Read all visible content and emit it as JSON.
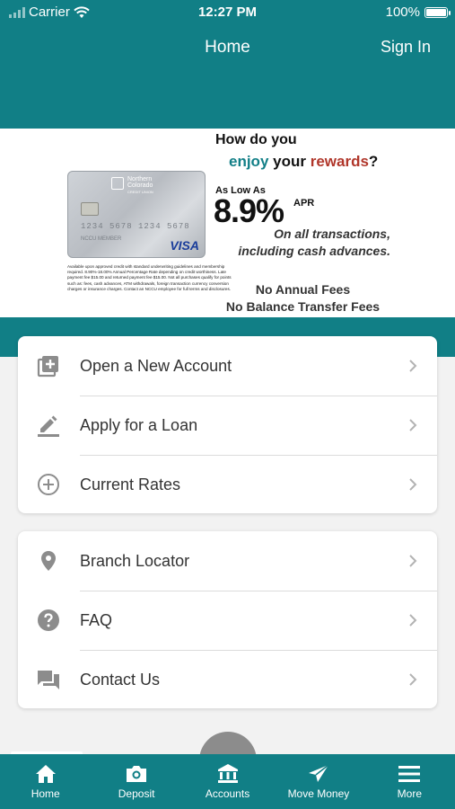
{
  "status_bar": {
    "carrier": "Carrier",
    "time": "12:27 PM",
    "battery": "100%"
  },
  "header": {
    "title": "Home",
    "sign_in": "Sign In"
  },
  "banner": {
    "headline_line1": "How do you",
    "headline_enjoy": "enjoy",
    "headline_your": " your ",
    "headline_rewards": "rewards",
    "headline_q": "?",
    "as_low_as": "As Low As",
    "rate": "8.9%",
    "apr": "APR",
    "on_all_1": "On all transactions,",
    "on_all_2": "including cash advances.",
    "no_annual": "No Annual Fees",
    "no_balance": "No Balance Transfer Fees",
    "card_bank_1": "Northern",
    "card_bank_2": "Colorado",
    "card_bank_3": "CREDIT UNION",
    "card_number": "1234 5678 1234 5678",
    "card_holder": "NCCU MEMBER",
    "card_brand": "VISA",
    "fine_print": "Available upon approved credit with standard underwriting guidelines and membership required. 8.90%-18.00% Annual Percentage Rate depending on credit worthiness. Late payment fee $15.00 and returned payment fee $15.00. Not all purchases qualify for points such as: fees, cash advances, ATM withdrawals, foreign transaction currency conversion charges or insurance charges. Contact an NCCU employee for full terms and disclosures."
  },
  "menu_group_1": [
    {
      "label": "Open a New Account",
      "icon": "add-box-icon"
    },
    {
      "label": "Apply for a Loan",
      "icon": "pencil-icon"
    },
    {
      "label": "Current Rates",
      "icon": "plus-circle-icon"
    }
  ],
  "menu_group_2": [
    {
      "label": "Branch Locator",
      "icon": "location-pin-icon"
    },
    {
      "label": "FAQ",
      "icon": "help-circle-icon"
    },
    {
      "label": "Contact Us",
      "icon": "chat-icon"
    }
  ],
  "tabs": [
    {
      "label": "Home",
      "icon": "home-icon"
    },
    {
      "label": "Deposit",
      "icon": "camera-icon"
    },
    {
      "label": "Accounts",
      "icon": "bank-icon"
    },
    {
      "label": "Move Money",
      "icon": "send-icon"
    },
    {
      "label": "More",
      "icon": "menu-icon"
    }
  ],
  "colors": {
    "brand": "#117f86",
    "accent_red": "#b0362a",
    "icon_gray": "#8c8c8c"
  }
}
